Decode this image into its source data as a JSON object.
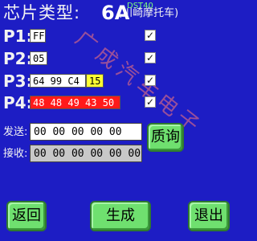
{
  "header": {
    "title_label": "芯片类型:",
    "chip_code": "6A",
    "chip_sub": "DST40",
    "maker": "(川崎摩托车)"
  },
  "rows": [
    {
      "label": "P1:",
      "cells": [
        "FF"
      ],
      "checked": true
    },
    {
      "label": "P2:",
      "cells": [
        "05"
      ],
      "checked": true
    },
    {
      "label": "P3:",
      "cells": [
        "64 99 C4",
        "15"
      ],
      "checked": true
    },
    {
      "label": "P4:",
      "cells": [
        "48 48 49 43 50"
      ],
      "checked": true
    }
  ],
  "send": {
    "label": "发送:",
    "value": "00 00 00 00 00"
  },
  "receive": {
    "label": "接收:",
    "value": "00 00 00 00 00 00"
  },
  "buttons": {
    "query": "质询",
    "back": "返回",
    "generate": "生成",
    "exit": "退出"
  },
  "checkmark": "✓",
  "watermark": "广成汽车电子",
  "colors": {
    "background": "#1d1dc4",
    "button": "#6fe06f",
    "highlight_yellow": "#ffff33",
    "highlight_red": "#ff1a1a",
    "chip_sub": "#7dff7d"
  }
}
